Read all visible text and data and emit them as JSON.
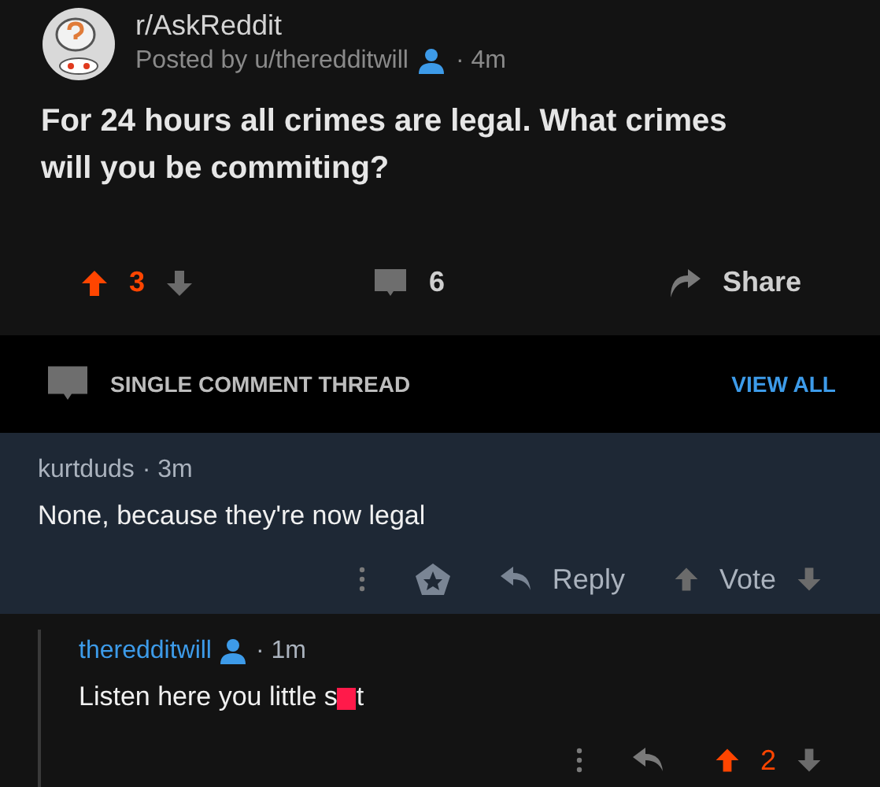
{
  "post": {
    "subreddit": "r/AskReddit",
    "posted_by": "Posted by u/theredditwill",
    "op": true,
    "time": "· 4m",
    "title": "For 24 hours all crimes are legal. What crimes will you be commiting?",
    "score": "3",
    "upvoted": true,
    "comments": "6",
    "share": "Share"
  },
  "thread_bar": {
    "label": "SINGLE COMMENT THREAD",
    "link": "VIEW ALL"
  },
  "comments": [
    {
      "author": "kurtduds",
      "op": false,
      "time": "· 3m",
      "body_before": "None, because they're now legal",
      "censored": false,
      "highlighted": true,
      "award": true,
      "reply": "Reply",
      "vote": "Vote",
      "upvoted": false
    },
    {
      "author": "theredditwill",
      "op": true,
      "time": "· 1m",
      "body_before": "Listen here you little s",
      "censored": true,
      "body_after": "t",
      "highlighted": false,
      "award": false,
      "score": "2",
      "upvoted": true
    }
  ]
}
